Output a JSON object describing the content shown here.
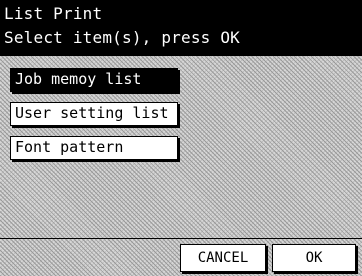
{
  "header": {
    "title": "List Print",
    "subtitle": "Select item(s), press OK"
  },
  "items": [
    {
      "label": "Job memoy list",
      "selected": true
    },
    {
      "label": "User setting list",
      "selected": false
    },
    {
      "label": "Font pattern",
      "selected": false
    }
  ],
  "footer": {
    "cancel_label": "CANCEL",
    "ok_label": "OK"
  },
  "colors": {
    "header_bg": "#000000",
    "header_text": "#ffffff",
    "button_bg": "#ffffff",
    "selected_bg": "#000000"
  }
}
